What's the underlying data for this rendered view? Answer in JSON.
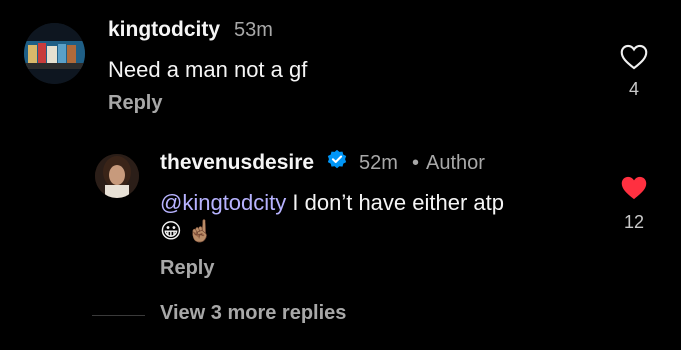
{
  "comment": {
    "username": "kingtodcity",
    "time": "53m",
    "text": "Need a man not a gf",
    "reply_label": "Reply",
    "like_count": "4",
    "liked": false
  },
  "reply": {
    "username": "thevenusdesire",
    "time": "52m",
    "separator": "•",
    "author_tag": "Author",
    "mention": "@kingtodcity",
    "text": "I don’t have either atp",
    "emojis": [
      "😀",
      "☝🏽"
    ],
    "reply_label": "Reply",
    "like_count": "12",
    "liked": true,
    "heart_color": "#ff3040",
    "verified_color": "#0095f6"
  },
  "thread": {
    "view_more_label": "View 3 more replies"
  }
}
